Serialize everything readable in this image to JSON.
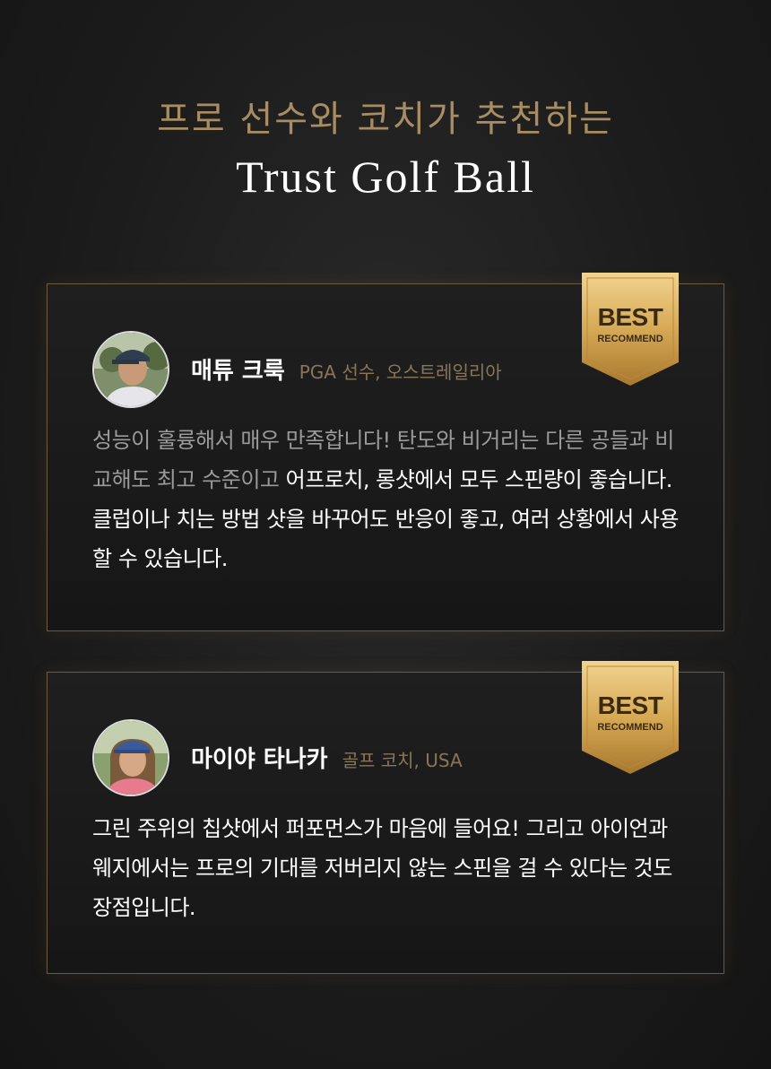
{
  "header": {
    "subtitle": "프로 선수와 코치가 추천하는",
    "title": "Trust Golf Ball"
  },
  "badge": {
    "best": "BEST",
    "recommend": "RECOMMEND"
  },
  "colors": {
    "accent_gold": "#c9a25c",
    "role_text": "#8a7556",
    "dim_text": "#9a9a9a",
    "border": "#6b5a3e"
  },
  "reviews": [
    {
      "name": "매튜 크룩",
      "role": "PGA 선수, 오스트레일리아",
      "quote_dim": "성능이 훌륭해서 매우 만족합니다! 탄도와 비거리는 다른 공들과 비교해도 최고 수준이고 ",
      "quote_bright": "어프로치, 롱샷에서 모두 스핀량이 좋습니다. 클럽이나 치는 방법 샷을 바꾸어도 반응이 좋고, 여러 상황에서 사용할 수 있습니다."
    },
    {
      "name": "마이야 타나카",
      "role": "골프 코치, USA",
      "quote": "그린 주위의 칩샷에서 퍼포먼스가 마음에 들어요! 그리고 아이언과 웨지에서는 프로의 기대를 저버리지 않는 스핀을 걸 수 있다는 것도 장점입니다."
    }
  ]
}
